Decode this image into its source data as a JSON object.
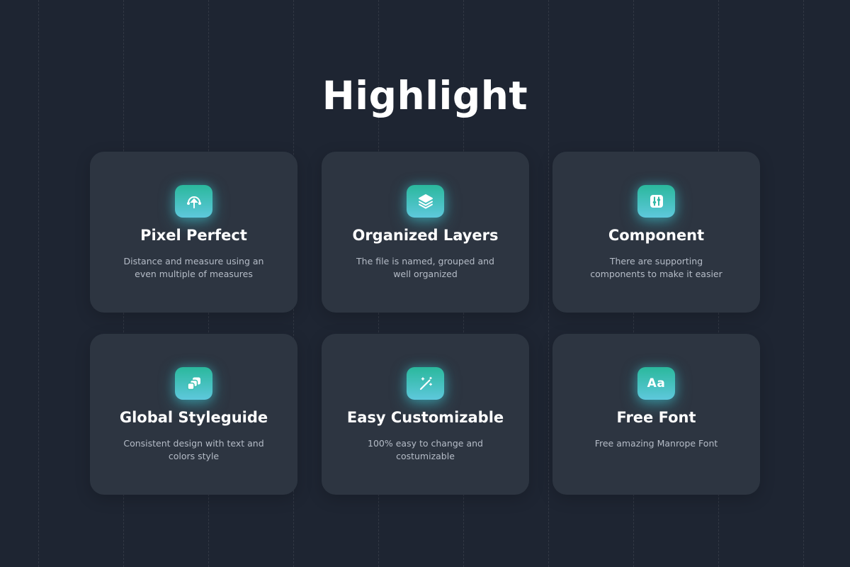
{
  "page": {
    "title": "Highlight"
  },
  "colors": {
    "background": "#1e2532",
    "card": "#2d3541",
    "icon_gradient_top": "#2ab89c",
    "icon_gradient_bottom": "#5ec8dc",
    "text_primary": "#ffffff",
    "text_secondary": "#b5bcc7"
  },
  "cards": [
    {
      "icon": "pixel-perfect-icon",
      "title": "Pixel Perfect",
      "desc": "Distance and measure using an even multiple of measures"
    },
    {
      "icon": "layers-icon",
      "title": "Organized Layers",
      "desc": "The file is named, grouped and well organized"
    },
    {
      "icon": "component-sliders-icon",
      "title": "Component",
      "desc": "There are supporting components to make it easier"
    },
    {
      "icon": "styleguide-icon",
      "title": "Global Styleguide",
      "desc": "Consistent design with text and colors style"
    },
    {
      "icon": "magic-wand-icon",
      "title": "Easy Customizable",
      "desc": "100% easy to change and costumizable"
    },
    {
      "icon": "font-aa-icon",
      "icon_text": "Aa",
      "title": "Free Font",
      "desc": "Free amazing Manrope  Font"
    }
  ]
}
